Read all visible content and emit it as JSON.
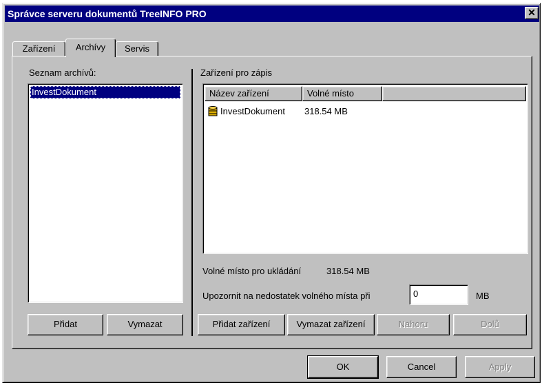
{
  "window": {
    "title": "Správce serveru dokumentů TreeINFO PRO",
    "close_glyph": "✕"
  },
  "tabs": [
    {
      "label": "Zařízení"
    },
    {
      "label": "Archívy"
    },
    {
      "label": "Servis"
    }
  ],
  "left": {
    "list_label": "Seznam archívů:",
    "items": [
      "InvestDokument"
    ],
    "add_label": "Přidat",
    "delete_label": "Vymazat"
  },
  "right": {
    "group_label": "Zařízení pro zápis",
    "columns": [
      "Název zařízení",
      "Volné místo"
    ],
    "rows": [
      {
        "icon": "database-icon",
        "name": "InvestDokument",
        "free": "318.54 MB"
      }
    ],
    "free_space_label": "Volné místo pro ukládání",
    "free_space_value": "318.54 MB",
    "warn_label": "Upozornit na nedostatek volného místa při",
    "warn_value": "0",
    "warn_unit": "MB",
    "buttons": {
      "add_device": "Přidat zařízení",
      "delete_device": "Vymazat zařízení",
      "up": "Nahoru",
      "down": "Dolů"
    }
  },
  "footer": {
    "ok": "OK",
    "cancel": "Cancel",
    "apply": "Apply"
  },
  "colors": {
    "titlebar": "#000080",
    "face": "#c0c0c0",
    "selection": "#000080"
  }
}
